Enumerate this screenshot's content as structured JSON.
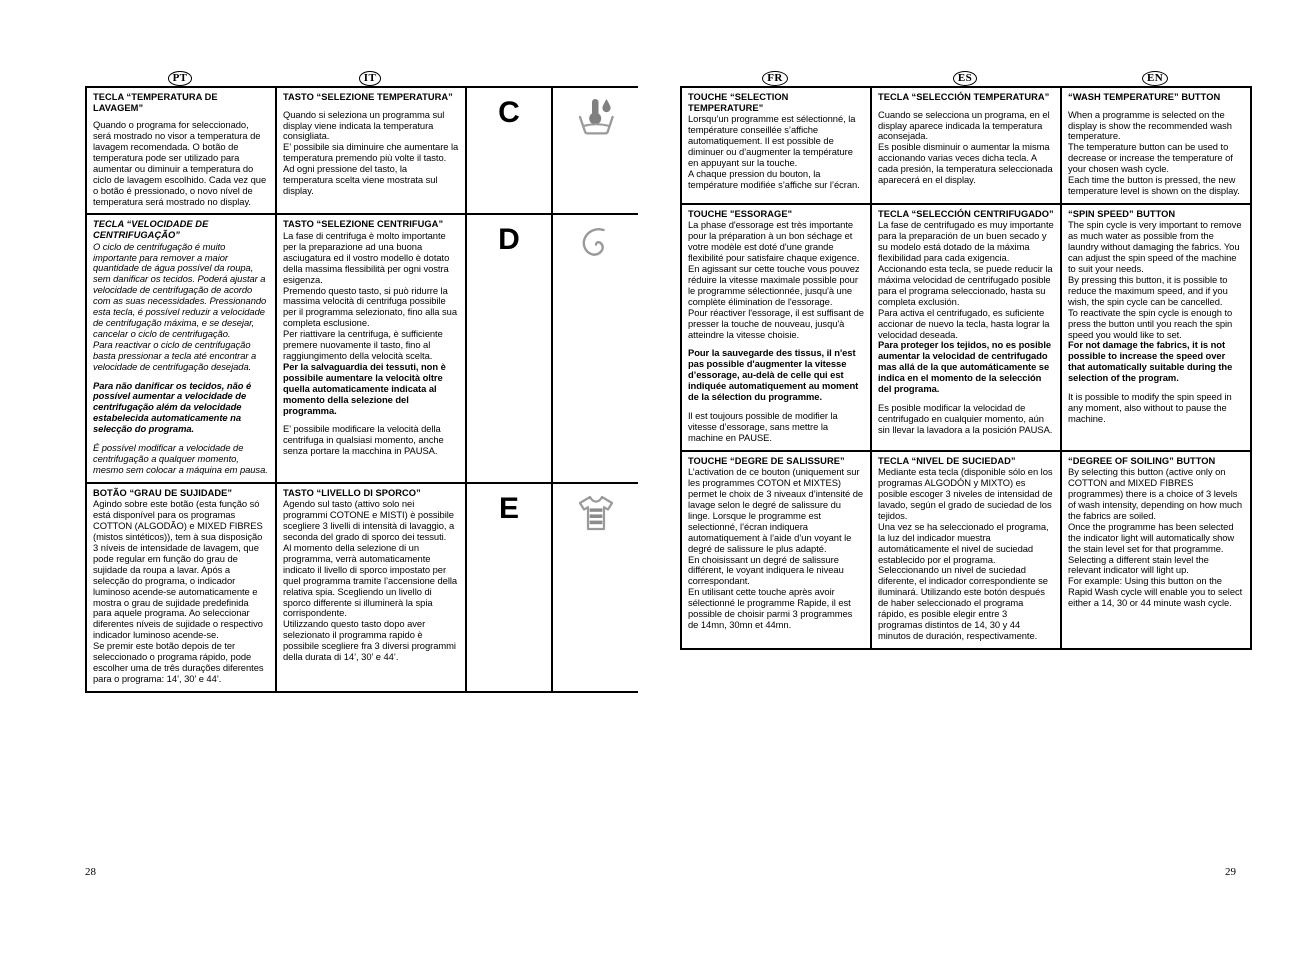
{
  "document": {
    "page_left": "28",
    "page_right": "29"
  },
  "flags": {
    "pt": "PT",
    "it": "IT",
    "fr": "FR",
    "es": "ES",
    "en": "EN"
  },
  "markers": {
    "c": "C",
    "d": "D",
    "e": "E"
  },
  "icons": {
    "c": "thermometer-water-basin-icon",
    "d": "spiral-spin-icon",
    "e": "striped-tshirt-icon"
  },
  "rows": [
    {
      "id": "row-c",
      "letter": "C",
      "icon": "thermometer-water-basin-icon",
      "pt": {
        "heading": "TECLA “TEMPERATURA DE LAVAGEM”",
        "paragraphs": [
          "Quando o programa for seleccionado, será mostrado no visor a temperatura de lavagem recomendada. O botão de temperatura pode ser utilizado para aumentar ou diminuir a temperatura do ciclo de lavagem escolhido. Cada vez que o botão é pressionado, o novo nível de temperatura será mostrado no display."
        ]
      },
      "it": {
        "heading": "TASTO “SELEZIONE TEMPERATURA”",
        "paragraphs": [
          "Quando si seleziona un programma sul display viene indicata la temperatura consigliata.\nE’ possibile sia diminuire che aumentare la temperatura premendo più volte il tasto.\nAd ogni pressione del tasto, la temperatura scelta viene mostrata sul display."
        ]
      },
      "fr": {
        "heading": "TOUCHE  “SELECTION TEMPERATURE”",
        "paragraphs": [
          "Lorsqu’un programme est sélectionné, la température conseillée s’affiche automatiquement. Il est possible de diminuer ou d’augmenter la température en appuyant sur la touche.\nA chaque pression du bouton, la température modifiée s’affiche sur l’écran."
        ]
      },
      "es": {
        "heading": "TECLA “SELECCIÓN TEMPERATURA”",
        "paragraphs": [
          "Cuando se selecciona un programa, en el display aparece indicada la temperatura aconsejada.\nEs posible disminuir o aumentar la misma accionando varias veces dicha tecla. A cada presión, la temperatura seleccionada aparecerá en el display."
        ]
      },
      "en": {
        "heading": "“WASH TEMPERATURE” BUTTON",
        "paragraphs": [
          "When a programme is selected on the display is show the recommended wash temperature.\nThe temperature button can be used to decrease or increase the temperature of your chosen wash cycle.\nEach time the button is pressed, the new temperature level is shown on the display."
        ]
      }
    },
    {
      "id": "row-d",
      "letter": "D",
      "icon": "spiral-spin-icon",
      "pt": {
        "heading": "TECLA “VELOCIDADE DE CENTRIFUGAÇÃO”",
        "heading_italic": true,
        "paragraphs": [
          "O ciclo de centrifugação é muito importante para remover a maior quantidade de água possível da roupa, sem danificar os tecidos. Poderá ajustar a velocidade de centrifugação de acordo com as suas necessidades. Pressionando esta tecla, é possível reduzir a velocidade de centrifugação máxima, e se desejar, cancelar o ciclo de centrifugação.\nPara reactivar o ciclo de centrifugação basta pressionar a tecla até encontrar a velocidade de centrifugação desejada."
        ],
        "bold_paragraph": "Para não danificar os tecidos, não é possível aumentar a velocidade de centrifugação além da velocidade estabelecida automaticamente na selecção do programa.",
        "tail_paragraph": "É possível modificar a velocidade de centrifugação a qualquer momento, mesmo sem colocar a máquina em pausa."
      },
      "it": {
        "heading": "TASTO “SELEZIONE CENTRIFUGA”",
        "paragraphs": [
          "La fase di centrifuga è molto importante per la preparazione ad una buona asciugatura ed il vostro modello è dotato della massima flessibilità per ogni vostra esigenza.\nPremendo questo tasto, si può ridurre la massima velocità di centrifuga possibile per il programma selezionato, fino alla sua completa esclusione.\nPer riattivare la centrifuga, è sufficiente premere nuovamente il tasto, fino al raggiungimento della velocità scelta."
        ],
        "bold_paragraph": "Per la salvaguardia dei tessuti, non è possibile aumentare la velocità oltre quella automaticamente indicata al momento della selezione del programma.",
        "tail_paragraph": "E' possibile modificare la velocità della centrifuga in qualsiasi momento, anche senza portare la macchina in PAUSA."
      },
      "fr": {
        "heading": "TOUCHE \"ESSORAGE\"",
        "paragraphs": [
          "La phase d'essorage est très importante pour la préparation à un bon séchage et votre modèle est doté d'une grande flexibilité pour satisfaire chaque exigence.\nEn agissant sur cette touche vous pouvez réduire la vitesse maximale possible pour le programme sélectionnée, jusqu'à une complète élimination de l'essorage.\nPour réactiver l'essorage, il est suffisant de presser la touche de nouveau, jusqu'à atteindre la vitesse choisie."
        ],
        "bold_paragraph": "Pour la sauvegarde des tissus, il n'est pas possible d'augmenter la vitesse d’essorage, au-delà de celle qui est indiquée automatiquement au moment de la sélection du programme.",
        "tail_paragraph": "Il est toujours possible de modifier la vitesse d’essorage, sans mettre la machine en PAUSE."
      },
      "es": {
        "heading": "TECLA “SELECCIÓN CENTRIFUGADO”",
        "paragraphs": [
          "La fase de  centrifugado es muy importante para la preparación de un buen secado y su modelo está dotado de la máxima flexibilidad para cada exigencia.\nAccionando esta tecla, se puede reducir la máxima velocidad de centrifugado posible para el programa seleccionado, hasta su completa exclusión.\nPara activa el centrifugado, es suficiente accionar de nuevo la tecla, hasta lograr la velocidad deseada."
        ],
        "bold_paragraph": "Para proteger los tejidos, no es posible aumentar la velocidad de centrifugado mas allá de la que automáticamente se indica en el momento de la selección del programa.",
        "tail_paragraph": "Es posible modificar la velocidad de centrifugado en cualquier momento, aún sin llevar la lavadora a la posición PAUSA."
      },
      "en": {
        "heading": "“SPIN SPEED” BUTTON",
        "paragraphs": [
          "The spin cycle is very important to remove as much water as possible from the laundry without damaging the fabrics. You can adjust the spin speed of the machine to suit your needs.\nBy pressing this button, it is possible to reduce the maximum speed, and if you wish, the spin cycle can be cancelled.\nTo reactivate the spin cycle is enough to press the button until you reach the spin speed you would like to set."
        ],
        "bold_paragraph": "For not damage the fabrics, it is not possible to increase the speed over that automatically suitable during the selection of the program.",
        "tail_paragraph": "It is possible to modify the spin speed in any moment, also without to pause the machine."
      }
    },
    {
      "id": "row-e",
      "letter": "E",
      "icon": "striped-tshirt-icon",
      "pt": {
        "heading": "BOTÃO “GRAU DE SUJIDADE”",
        "paragraphs": [
          "Agindo sobre este botão (esta função só está disponível para os programas COTTON (ALGODÃO) e MIXED FIBRES (mistos sintéticos)), tem à sua disposição 3 níveis de intensidade de lavagem, que pode regular em função do grau de sujidade da roupa a lavar. Após a selecção do programa, o indicador luminoso acende-se automaticamente e mostra o grau de sujidade predefinida para aquele programa. Ao seleccionar diferentes níveis de sujidade o respectivo indicador luminoso acende-se.\nSe premir este botão depois de ter seleccionado o programa rápido, pode escolher uma de três durações diferentes para o programa: 14’, 30’ e 44’."
        ]
      },
      "it": {
        "heading": "TASTO “LIVELLO DI SPORCO”",
        "paragraphs": [
          "Agendo sul tasto (attivo solo nei programmi COTONE e MISTI) è possibile scegliere 3 livelli di intensità di lavaggio, a seconda del grado di sporco dei tessuti.\nAl momento della selezione di un programma, verrà automaticamente indicato il livello di sporco impostato per quel programma tramite l’accensione della relativa spia. Scegliendo un livello di sporco differente si illuminerà la spia corrispondente.\nUtilizzando questo tasto dopo aver selezionato il programma rapido è possibile scegliere fra 3 diversi programmi della durata di 14’, 30’ e 44’."
        ]
      },
      "fr": {
        "heading": "TOUCHE “DEGRE DE SALISSURE”",
        "paragraphs": [
          "L’activation de ce bouton (uniquement sur les programmes COTON et MIXTES) permet le choix de 3 niveaux d’intensité de lavage selon le degré de salissure du linge. Lorsque le programme est selectionné, l’écran indiquera automatiquement à l’aide d’un voyant le degré de salissure le plus adapté.\nEn choisissant un degré de salissure différent, le voyant indiquera le niveau correspondant.\nEn utilisant cette touche après avoir sélectionné le programme Rapide, il est possible de choisir parmi 3 programmes de 14mn, 30mn et 44mn."
        ]
      },
      "es": {
        "heading": "TECLA “NIVEL DE SUCIEDAD”",
        "paragraphs": [
          "Mediante esta tecla (disponible sólo en los programas ALGODÓN y MIXTO) es posible escoger 3 niveles de intensidad de lavado, según el grado de suciedad de los tejidos.\nUna vez se ha seleccionado el programa, la luz del indicador muestra automáticamente el nivel de suciedad  establecido por el programa. Seleccionando un nivel de suciedad diferente, el indicador correspondiente se iluminará. Utilizando este botón después de haber seleccionado el programa rápido, es posible elegir entre 3 programas distintos de 14, 30 y 44 minutos de duración, respectivamente."
        ]
      },
      "en": {
        "heading": "“DEGREE OF SOILING” BUTTON",
        "paragraphs": [
          "By selecting this button (active only on COTTON and MIXED FIBRES programmes) there is a choice of 3 levels of wash intensity, depending on how much the fabrics are soiled.\nOnce the programme has been selected the indicator light will automatically show the stain level set for that programme. Selecting a different stain level the relevant indicator will light up.\nFor example: Using this button on the Rapid Wash cycle will enable you to select either a 14, 30 or 44 minute wash cycle."
        ]
      }
    }
  ]
}
